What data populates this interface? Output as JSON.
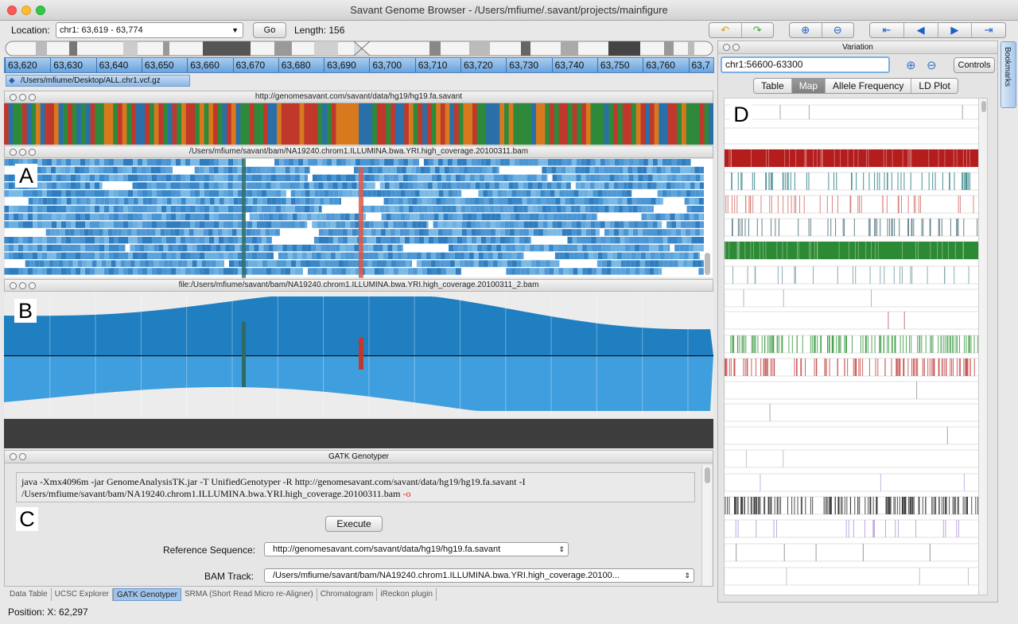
{
  "window": {
    "title": "Savant Genome Browser - /Users/mfiume/.savant/projects/mainfigure"
  },
  "toolbar": {
    "location_label": "Location:",
    "location_value": "chr1: 63,619 - 63,774",
    "go_label": "Go",
    "length_label": "Length: 156",
    "undo_icon": "undo-arrow-icon",
    "redo_icon": "redo-arrow-icon",
    "zoom_in_icon": "zoom-in-icon",
    "zoom_out_icon": "zoom-out-icon",
    "nav_icons": [
      "skip-start-icon",
      "arrow-left-icon",
      "arrow-right-icon",
      "skip-end-icon"
    ]
  },
  "ruler": {
    "ticks": [
      "63,620",
      "63,630",
      "63,640",
      "63,650",
      "63,660",
      "63,670",
      "63,680",
      "63,690",
      "63,700",
      "63,710",
      "63,720",
      "63,730",
      "63,740",
      "63,750",
      "63,760",
      "63,7"
    ]
  },
  "file_tab": {
    "label": "/Users/mfiume/Desktop/ALL.chr1.vcf.gz"
  },
  "tracks": {
    "sequence": {
      "title": "http://genomesavant.com/savant/data/hg19/hg19.fa.savant"
    },
    "reads": {
      "title": "/Users/mfiume/savant/bam/NA19240.chrom1.ILLUMINA.bwa.YRI.high_coverage.20100311.bam",
      "letter": "A"
    },
    "coverage": {
      "title": "file:/Users/mfiume/savant/bam/NA19240.chrom1.ILLUMINA.bwa.YRI.high_coverage.20100311_2.bam",
      "letter": "B"
    }
  },
  "gatk": {
    "title": "GATK Genotyper",
    "letter": "C",
    "command_line1": "java -Xmx4096m -jar GenomeAnalysisTK.jar -T UnifiedGenotyper -R http://genomesavant.com/savant/data/hg19/hg19.fa.savant -I",
    "command_line2": "/Users/mfiume/savant/bam/NA19240.chrom1.ILLUMINA.bwa.YRI.high_coverage.20100311.bam",
    "command_flag": "-o",
    "execute_label": "Execute",
    "ref_label": "Reference Sequence:",
    "ref_value": "http://genomesavant.com/savant/data/hg19/hg19.fa.savant",
    "bam_label": "BAM Track:",
    "bam_value": "/Users/mfiume/savant/bam/NA19240.chrom1.ILLUMINA.bwa.YRI.high_coverage.20100..."
  },
  "bottom_tabs": [
    "Data Table",
    "UCSC Explorer",
    "GATK Genotyper",
    "SRMA (Short Read Micro re-Aligner)",
    "Chromatogram",
    "iReckon plugin"
  ],
  "active_bottom_tab": "GATK Genotyper",
  "status": {
    "position": "Position: X: 62,297"
  },
  "variation": {
    "title": "Variation",
    "range_value": "chr1:56600-63300",
    "controls_label": "Controls",
    "tabs": [
      "Table",
      "Map",
      "Allele Frequency",
      "LD Plot"
    ],
    "selected_tab": "Map",
    "letter": "D"
  },
  "bookmarks": {
    "label": "Bookmarks"
  },
  "colors": {
    "ruler_blue": "#6aa3dc",
    "coverage_blue": "#1f7fc1",
    "coverage_light": "#3f9ede",
    "variant_red": "#b51d1d",
    "variant_green": "#2d8a34"
  }
}
